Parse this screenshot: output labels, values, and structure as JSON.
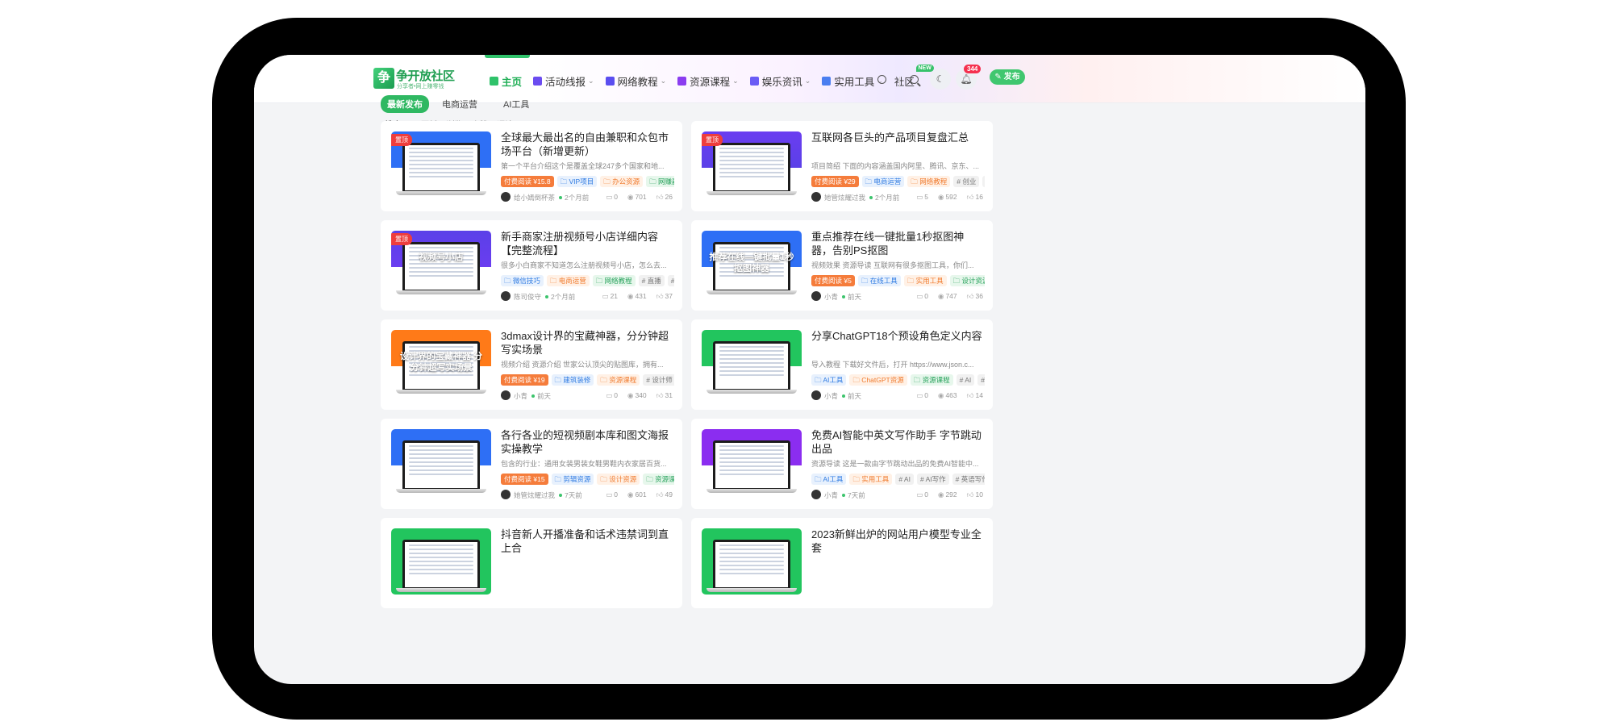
{
  "logo": {
    "mark": "争",
    "title": "争开放社区",
    "subtitle": "分享者•网上赚零钱"
  },
  "nav": [
    {
      "label": "主页",
      "icon": "home-icon",
      "color": "#2fc26a",
      "active": true,
      "chevron": false
    },
    {
      "label": "活动线报",
      "icon": "flag-icon",
      "color": "#6b4cf0",
      "chevron": true
    },
    {
      "label": "网络教程",
      "icon": "book-icon",
      "color": "#5a4ef0",
      "chevron": true
    },
    {
      "label": "资源课程",
      "icon": "course-icon",
      "color": "#8b3df0",
      "chevron": true
    },
    {
      "label": "娱乐资讯",
      "icon": "chat-icon",
      "color": "#6a5cf5",
      "chevron": true
    },
    {
      "label": "实用工具",
      "icon": "gear-icon",
      "color": "#4a7ef0",
      "chevron": true
    },
    {
      "label": "社区",
      "icon": "",
      "color": "",
      "chevron": false,
      "badge": "NEW"
    }
  ],
  "header": {
    "notification_count": "344",
    "publish_label": "发布"
  },
  "tabs": [
    {
      "label": "最新发布",
      "active": true
    },
    {
      "label": "电商运营"
    },
    {
      "label": "AI工具"
    }
  ],
  "sort": {
    "label": "排序",
    "options": [
      "更新",
      "浏览",
      "点赞",
      "评论"
    ]
  },
  "cards": [
    {
      "title": "全球最大最出名的自由兼职和众包市场平台（新增更新）",
      "excerpt": "第一个平台介绍这个是覆盖全球247多个国家和地...",
      "pinned": "置顶",
      "tags": [
        {
          "text": "付费阅读 ¥15.8",
          "style": "paid"
        },
        {
          "text": "VIP项目",
          "style": "blue"
        },
        {
          "text": "办公资源",
          "style": "orange"
        },
        {
          "text": "网赚副业",
          "style": "green"
        }
      ],
      "author": "给小嫣倒杯茶",
      "time": "2个月前",
      "comments": "0",
      "views": "701",
      "likes": "26",
      "thumb_bg": "linear-gradient(#2e6ff5,#2e6ff5 55%,#ffffff 55%)",
      "thumb_caption": ""
    },
    {
      "title": "互联网各巨头的产品项目复盘汇总",
      "excerpt": "项目简绍 下面的内容涵盖国内阿里、腾讯、京东、...",
      "pinned": "置顶",
      "tags": [
        {
          "text": "付费阅读 ¥29",
          "style": "paid"
        },
        {
          "text": "电商运营",
          "style": "blue"
        },
        {
          "text": "网络教程",
          "style": "orange"
        },
        {
          "text": "# 创业",
          "style": "gray"
        },
        {
          "text": "# 分享",
          "style": "gray"
        }
      ],
      "author": "她管炫耀过我",
      "time": "2个月前",
      "comments": "5",
      "views": "592",
      "likes": "16",
      "thumb_bg": "linear-gradient(#6a3df0,#5b40e8 55%,#ffffff 55%)",
      "thumb_caption": ""
    },
    {
      "title": "新手商家注册视频号小店详细内容【完整流程】",
      "excerpt": "很多小白商家不知道怎么注册视频号小店，怎么去...",
      "pinned": "置顶",
      "tags": [
        {
          "text": "微信技巧",
          "style": "blue"
        },
        {
          "text": "电商运营",
          "style": "orange"
        },
        {
          "text": "网络教程",
          "style": "green"
        },
        {
          "text": "# 直播",
          "style": "gray"
        },
        {
          "text": "# 视频号",
          "style": "gray"
        }
      ],
      "author": "陈司俊守",
      "time": "2个月前",
      "comments": "21",
      "views": "431",
      "likes": "37",
      "thumb_bg": "linear-gradient(#5b40e8,#6a3df0 55%,#ffffff 55%)",
      "thumb_caption": "视频号小店"
    },
    {
      "title": "重点推荐在线一键批量1秒抠图神器，告别PS抠图",
      "excerpt": "视频效果 资源导读 互联网有很多抠图工具，你们...",
      "pinned": "",
      "tags": [
        {
          "text": "付费阅读 ¥5",
          "style": "paid"
        },
        {
          "text": "在线工具",
          "style": "blue"
        },
        {
          "text": "实用工具",
          "style": "orange"
        },
        {
          "text": "设计资源",
          "style": "green"
        }
      ],
      "author": "小青",
      "time": "前天",
      "comments": "0",
      "views": "747",
      "likes": "36",
      "thumb_bg": "linear-gradient(#2e6ff5,#2e6ff5 55%,#ffffff 55%)",
      "thumb_caption": "推荐在线一键批量1秒抠图神器"
    },
    {
      "title": "3dmax设计界的宝藏神器，分分钟超写实场景",
      "excerpt": "视频介绍 资源介绍 世家公认顶尖的贴图库，拥有...",
      "pinned": "",
      "tags": [
        {
          "text": "付费阅读 ¥19",
          "style": "paid"
        },
        {
          "text": "建筑装修",
          "style": "blue"
        },
        {
          "text": "资源课程",
          "style": "orange"
        },
        {
          "text": "# 设计师",
          "style": "gray"
        },
        {
          "text": "# 3dmax",
          "style": "gray"
        }
      ],
      "author": "小青",
      "time": "前天",
      "comments": "0",
      "views": "340",
      "likes": "31",
      "thumb_bg": "linear-gradient(#ff7a18,#ff7a18 55%,#ffffff 55%)",
      "thumb_caption": "设计界的宝藏神器 分分钟超写实场景"
    },
    {
      "title": "分享ChatGPT18个预设角色定义内容",
      "excerpt": "导入教程 下载好文件后，打开 https://www.json.c...",
      "pinned": "",
      "tags": [
        {
          "text": "AI工具",
          "style": "blue"
        },
        {
          "text": "ChatGPT资源",
          "style": "orange"
        },
        {
          "text": "资源课程",
          "style": "green"
        },
        {
          "text": "# AI",
          "style": "gray"
        },
        {
          "text": "# ChatGPT",
          "style": "gray"
        }
      ],
      "author": "小青",
      "time": "前天",
      "comments": "0",
      "views": "463",
      "likes": "14",
      "thumb_bg": "linear-gradient(#22c55e,#22c55e 55%,#ffffff 55%)",
      "thumb_caption": ""
    },
    {
      "title": "各行各业的短视频剧本库和图文海报实操教学",
      "excerpt": "包含的行业：通用女装男装女鞋男鞋内衣家居百货...",
      "pinned": "",
      "tags": [
        {
          "text": "付费阅读 ¥15",
          "style": "paid"
        },
        {
          "text": "剪辑资源",
          "style": "blue"
        },
        {
          "text": "设计资源",
          "style": "orange"
        },
        {
          "text": "资源课程",
          "style": "green"
        }
      ],
      "author": "她管炫耀过我",
      "time": "7天前",
      "comments": "0",
      "views": "601",
      "likes": "49",
      "thumb_bg": "linear-gradient(#2e6ff5,#2e6ff5 55%,#ffffff 55%)",
      "thumb_caption": ""
    },
    {
      "title": "免费AI智能中英文写作助手 字节跳动出品",
      "excerpt": "资源导读 这是一款由字节跳动出品的免费AI智能中...",
      "pinned": "",
      "tags": [
        {
          "text": "AI工具",
          "style": "blue"
        },
        {
          "text": "实用工具",
          "style": "orange"
        },
        {
          "text": "# AI",
          "style": "gray"
        },
        {
          "text": "# AI写作",
          "style": "gray"
        },
        {
          "text": "# 英语写作",
          "style": "gray"
        }
      ],
      "author": "小青",
      "time": "7天前",
      "comments": "0",
      "views": "292",
      "likes": "10",
      "thumb_bg": "linear-gradient(#8b2df0,#8b2df0 55%,#ffffff 55%)",
      "thumb_caption": ""
    },
    {
      "title": "抖音新人开播准备和话术违禁词到直上合",
      "excerpt": "",
      "pinned": "",
      "tags": [],
      "author": "",
      "time": "",
      "comments": "",
      "views": "",
      "likes": "",
      "thumb_bg": "linear-gradient(#22c55e,#22c55e)",
      "thumb_caption": ""
    },
    {
      "title": "2023新鲜出炉的网站用户模型专业全套",
      "excerpt": "",
      "pinned": "",
      "tags": [],
      "author": "",
      "time": "",
      "comments": "",
      "views": "",
      "likes": "",
      "thumb_bg": "linear-gradient(#22c55e,#22c55e)",
      "thumb_caption": ""
    }
  ]
}
